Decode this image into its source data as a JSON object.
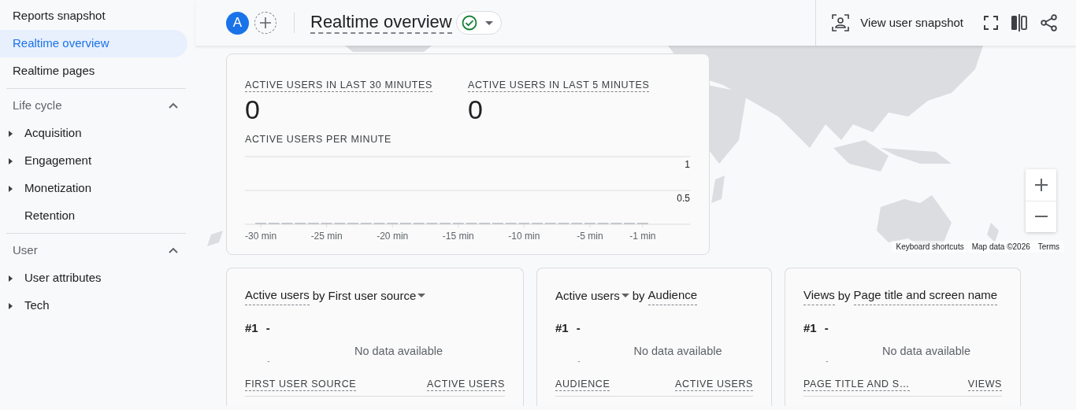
{
  "sidebar": {
    "items": [
      {
        "label": "Reports snapshot",
        "selected": false
      },
      {
        "label": "Realtime overview",
        "selected": true
      },
      {
        "label": "Realtime pages",
        "selected": false
      }
    ],
    "sections": [
      {
        "title": "Life cycle",
        "expanded": true,
        "items": [
          {
            "label": "Acquisition",
            "expandable": true
          },
          {
            "label": "Engagement",
            "expandable": true
          },
          {
            "label": "Monetization",
            "expandable": true
          },
          {
            "label": "Retention",
            "expandable": false
          }
        ]
      },
      {
        "title": "User",
        "expanded": true,
        "items": [
          {
            "label": "User attributes",
            "expandable": true
          },
          {
            "label": "Tech",
            "expandable": true
          }
        ]
      }
    ]
  },
  "header": {
    "avatar": "A",
    "title": "Realtime overview",
    "verified": true,
    "snapshot_button": "View user snapshot"
  },
  "overview": {
    "metrics": [
      {
        "label": "ACTIVE USERS IN LAST 30 MINUTES",
        "value": "0"
      },
      {
        "label": "ACTIVE USERS IN LAST 5 MINUTES",
        "value": "0"
      }
    ],
    "chart_title": "ACTIVE USERS PER MINUTE",
    "chart_data": {
      "type": "bar",
      "x": [
        -30,
        -29,
        -28,
        -27,
        -26,
        -25,
        -24,
        -23,
        -22,
        -21,
        -20,
        -19,
        -18,
        -17,
        -16,
        -15,
        -14,
        -13,
        -12,
        -11,
        -10,
        -9,
        -8,
        -7,
        -6,
        -5,
        -4,
        -3,
        -2,
        -1
      ],
      "values": [
        0,
        0,
        0,
        0,
        0,
        0,
        0,
        0,
        0,
        0,
        0,
        0,
        0,
        0,
        0,
        0,
        0,
        0,
        0,
        0,
        0,
        0,
        0,
        0,
        0,
        0,
        0,
        0,
        0,
        0
      ],
      "xticks": [
        {
          "value": -30,
          "label": "-30 min"
        },
        {
          "value": -25,
          "label": "-25 min"
        },
        {
          "value": -20,
          "label": "-20 min"
        },
        {
          "value": -15,
          "label": "-15 min"
        },
        {
          "value": -10,
          "label": "-10 min"
        },
        {
          "value": -5,
          "label": "-5 min"
        },
        {
          "value": -1,
          "label": "-1 min"
        }
      ],
      "yticks": [
        {
          "value": 0.5,
          "label": "0.5"
        },
        {
          "value": 1,
          "label": "1"
        }
      ],
      "xlim": [
        -31.2,
        2.6
      ],
      "ylim": [
        0,
        1
      ]
    }
  },
  "map": {
    "attribution": [
      "Keyboard shortcuts",
      "Map data ©2026",
      "Terms"
    ]
  },
  "cards": [
    {
      "metric": {
        "text": "Active users",
        "underlined": true,
        "dropdown": false
      },
      "by": "by",
      "dimension": {
        "text": "First user source",
        "underlined": false,
        "dropdown": true
      },
      "rank": "#1",
      "rank_value": "-",
      "axis_mark": "-",
      "message": "No data available",
      "columns": [
        "FIRST USER SOURCE",
        "ACTIVE USERS"
      ]
    },
    {
      "metric": {
        "text": "Active users",
        "underlined": false,
        "dropdown": true
      },
      "by": "by",
      "dimension": {
        "text": "Audience",
        "underlined": true,
        "dropdown": false
      },
      "rank": "#1",
      "rank_value": "-",
      "axis_mark": "-",
      "message": "No data available",
      "columns": [
        "AUDIENCE",
        "ACTIVE USERS"
      ]
    },
    {
      "metric": {
        "text": "Views",
        "underlined": true,
        "dropdown": false
      },
      "by": "by",
      "dimension": {
        "text": "Page title and screen name",
        "underlined": true,
        "dropdown": false
      },
      "rank": "#1",
      "rank_value": "-",
      "axis_mark": "-",
      "message": "No data available",
      "columns": [
        "PAGE TITLE AND S…",
        "VIEWS"
      ]
    }
  ]
}
